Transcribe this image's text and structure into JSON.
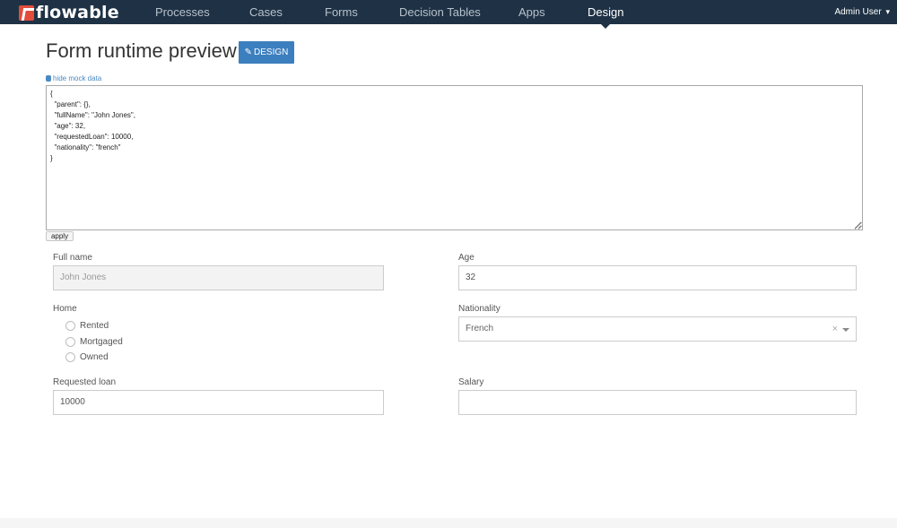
{
  "nav": {
    "logo_text": "flowable",
    "items": [
      {
        "label": "Processes"
      },
      {
        "label": "Cases"
      },
      {
        "label": "Forms"
      },
      {
        "label": "Decision Tables"
      },
      {
        "label": "Apps"
      },
      {
        "label": "Design"
      }
    ],
    "active": "Design",
    "user": "Admin User",
    "user_chevron": "⌄"
  },
  "page": {
    "title": "Form runtime preview",
    "design_button": "DESIGN",
    "design_icon": "pencil-icon"
  },
  "mock": {
    "toggle_label": "hide mock data",
    "toggle_icon": "database-icon",
    "json_text": "{\n  \"parent\": {},\n  \"fullName\": \"John Jones\",\n  \"age\": 32,\n  \"requestedLoan\": 10000,\n  \"nationality\": \"french\"\n}",
    "apply_label": "apply"
  },
  "form": {
    "full_name": {
      "label": "Full name",
      "value": "John Jones"
    },
    "age": {
      "label": "Age",
      "value": "32"
    },
    "home": {
      "label": "Home",
      "options": [
        "Rented",
        "Mortgaged",
        "Owned"
      ]
    },
    "nationality": {
      "label": "Nationality",
      "value": "French",
      "clear": "×"
    },
    "requested_loan": {
      "label": "Requested loan",
      "value": "10000"
    },
    "salary": {
      "label": "Salary",
      "value": ""
    }
  },
  "colors": {
    "navbar": "#1f3245",
    "accent": "#3c7fbf",
    "logo_red": "#e24d3b"
  }
}
